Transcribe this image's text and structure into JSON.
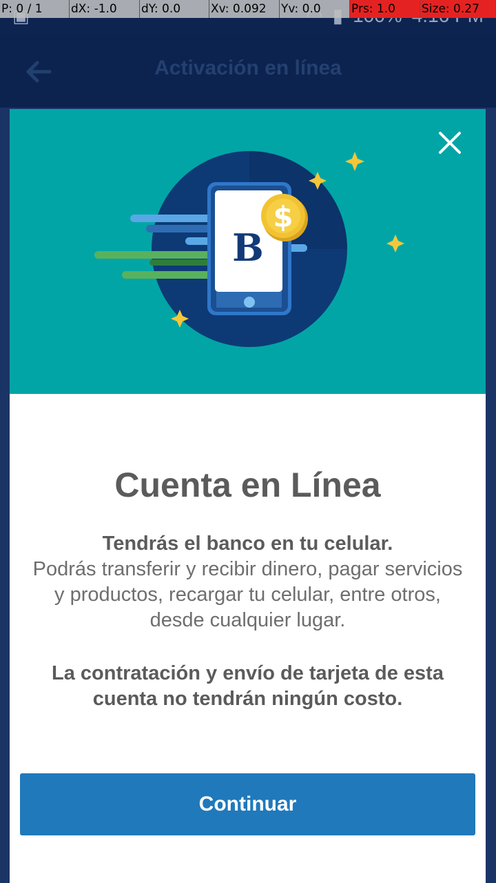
{
  "debug": {
    "cells": [
      "P: 0 / 1",
      "dX: -1.0",
      "dY: 0.0",
      "Xv: 0.092",
      "Yv: 0.0",
      "Prs: 1.0",
      "Size: 0.27"
    ]
  },
  "status_bar": {
    "battery": "100%",
    "time": "4:16 PM"
  },
  "app_bar": {
    "title": "Activación en línea"
  },
  "modal": {
    "hero_logo": "B",
    "coin_symbol": "$",
    "title": "Cuenta en Línea",
    "lead": "Tendrás el banco en tu celular.",
    "body": "Podrás transferir y recibir dinero, pagar servicios y productos, recargar tu celular, entre otros, desde cualquier lugar.",
    "note": "La contratación y envío de tarjeta de esta cuenta no tendrán ningún costo.",
    "continue_label": "Continuar"
  },
  "colors": {
    "hero_bg": "#02a5a6",
    "button": "#2079bb",
    "app_bar": "#0c2350",
    "coin": "#f2c230"
  }
}
